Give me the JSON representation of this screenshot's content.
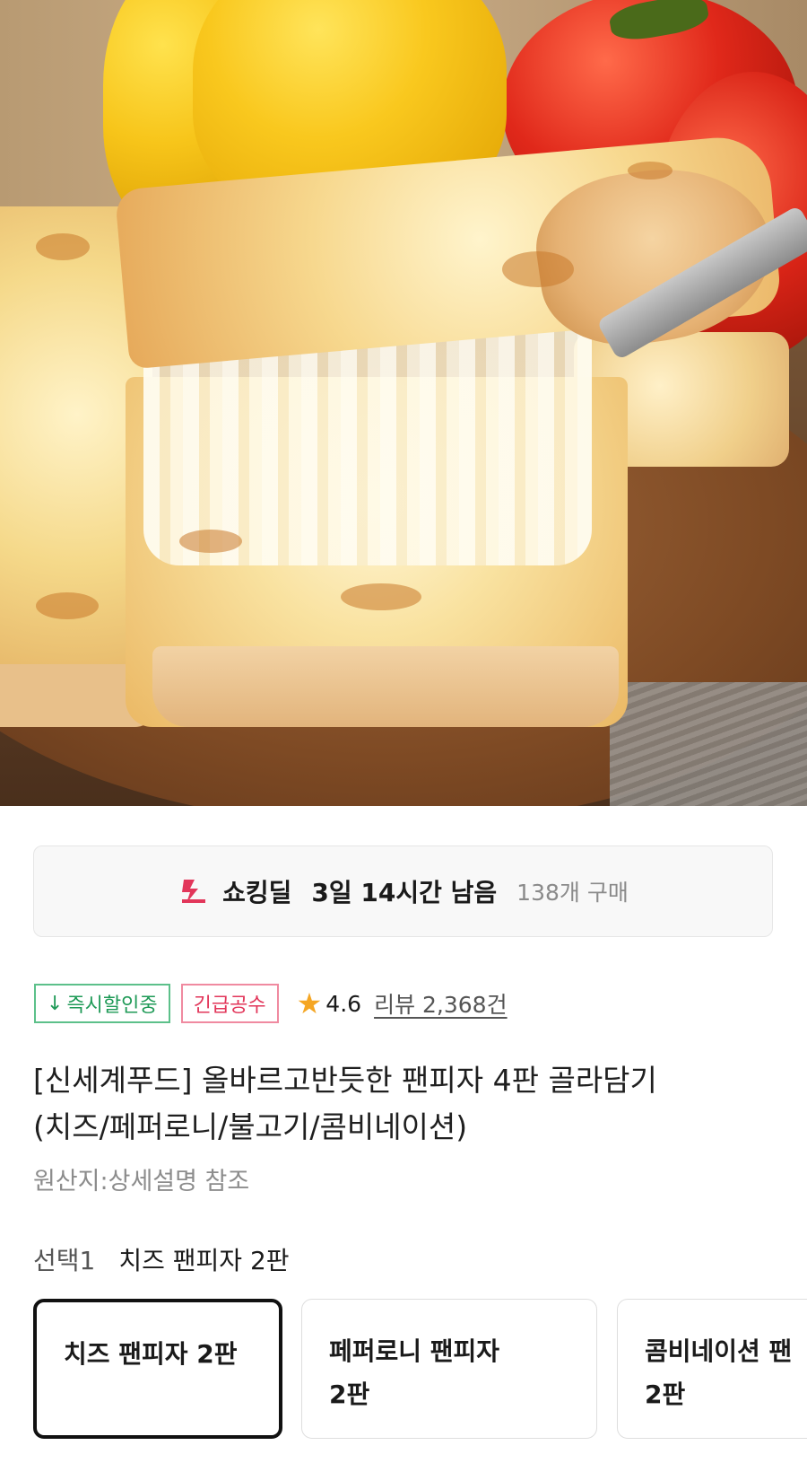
{
  "hero": {
    "image_icon": "pizza-photo"
  },
  "deal": {
    "icon": "bolt-icon",
    "name": "쇼킹딜",
    "time_left": "3일 14시간 남음",
    "purchase_count": "138개 구매"
  },
  "badges": {
    "instant_discount": "즉시할인중",
    "instant_discount_icon": "arrow-down-icon",
    "urgent": "긴급공수"
  },
  "rating": {
    "score": "4.6",
    "reviews": "리뷰 2,368건"
  },
  "product": {
    "title_line1": "[신세계푸드] 올바르고반듯한 팬피자 4판 골라담기",
    "title_line2": "(치즈/페퍼로니/불고기/콤비네이션)",
    "origin": "원산지:상세설명 참조"
  },
  "option": {
    "label": "선택1",
    "selected_value": "치즈 팬피자 2판",
    "cards": [
      {
        "line1": "치즈 팬피자 2판",
        "line2": "",
        "selected": true
      },
      {
        "line1": "페퍼로니 팬피자",
        "line2": "2판",
        "selected": false
      },
      {
        "line1": "콤비네이션 팬",
        "line2": "2판",
        "selected": false
      }
    ]
  },
  "colors": {
    "accent_red": "#e2365a",
    "accent_green": "#1f9a57",
    "star": "#f5a623"
  }
}
